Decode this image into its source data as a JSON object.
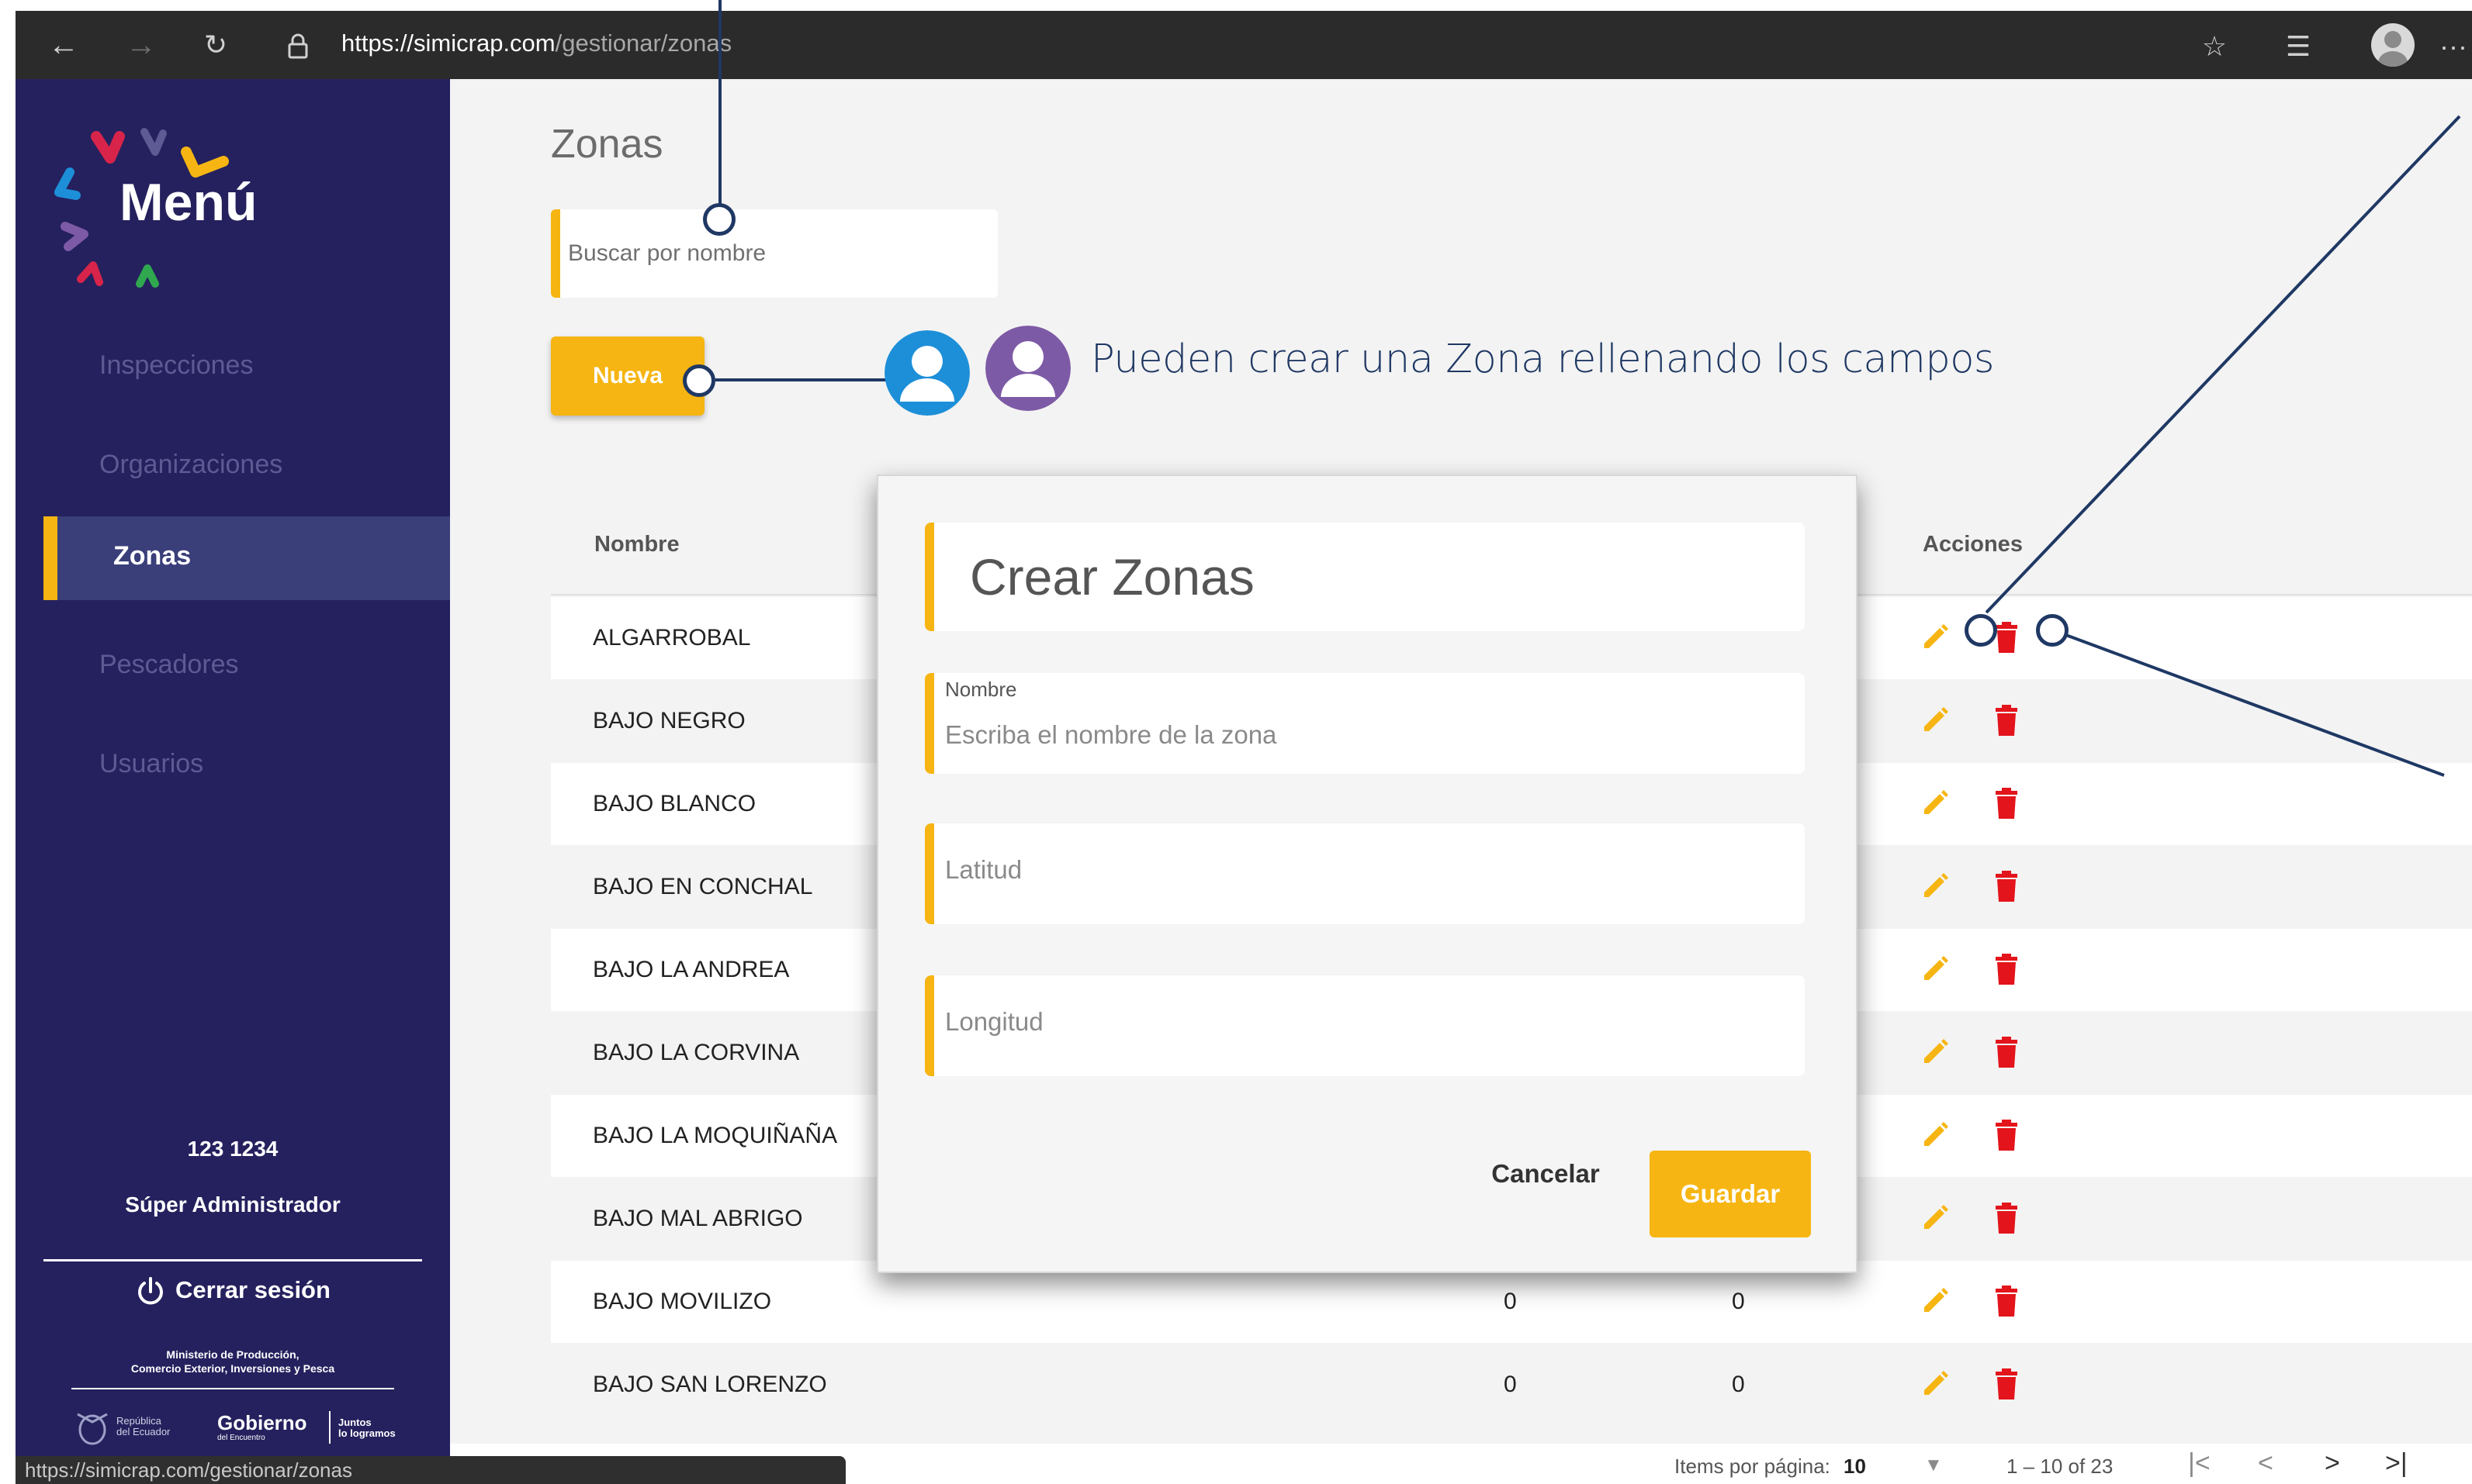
{
  "browser": {
    "url_host": "https://simicrap.com",
    "url_path": "/gestionar/zonas",
    "back_icon": "arrow-left-icon",
    "forward_icon": "arrow-right-icon",
    "refresh_icon": "refresh-icon",
    "lock_icon": "lock-icon",
    "favorite_icon": "star-icon",
    "collections_icon": "favorites-list-icon",
    "profile_icon": "profile-avatar-icon",
    "more_icon": "more-horizontal-icon",
    "status_url": "https://simicrap.com/gestionar/zonas"
  },
  "sidebar": {
    "title": "Menú",
    "items": [
      {
        "label": "Inspecciones",
        "active": false
      },
      {
        "label": "Organizaciones",
        "active": false
      },
      {
        "label": "Zonas",
        "active": true
      },
      {
        "label": "Pescadores",
        "active": false
      },
      {
        "label": "Usuarios",
        "active": false
      }
    ],
    "user_number": "123 1234",
    "user_role": "Súper Administrador",
    "logout_label": "Cerrar sesión",
    "ministry_line1": "Ministerio de Producción,",
    "ministry_line2": "Comercio Exterior, Inversiones y Pesca",
    "republic_line1": "República",
    "republic_line2": "del Ecuador",
    "gob_label": "Gobierno",
    "gob_sub": "del Encuentro",
    "juntos_line1": "Juntos",
    "juntos_line2": "lo logramos"
  },
  "main": {
    "title": "Zonas",
    "search_placeholder": "Buscar por nombre",
    "new_button": "Nueva",
    "annotation": "Pueden crear una Zona rellenando los campos",
    "table": {
      "col_name": "Nombre",
      "col_actions": "Acciones",
      "rows": [
        {
          "name": "ALGARROBAL",
          "v1": "",
          "v2": ""
        },
        {
          "name": "BAJO NEGRO",
          "v1": "",
          "v2": ""
        },
        {
          "name": "BAJO BLANCO",
          "v1": "",
          "v2": ""
        },
        {
          "name": "BAJO EN CONCHAL",
          "v1": "",
          "v2": ""
        },
        {
          "name": "BAJO LA ANDREA",
          "v1": "",
          "v2": ""
        },
        {
          "name": "BAJO LA CORVINA",
          "v1": "",
          "v2": ""
        },
        {
          "name": "BAJO LA MOQUIÑAÑA",
          "v1": "",
          "v2": ""
        },
        {
          "name": "BAJO MAL ABRIGO",
          "v1": "",
          "v2": ""
        },
        {
          "name": "BAJO MOVILIZO",
          "v1": "0",
          "v2": "0"
        },
        {
          "name": "BAJO SAN LORENZO",
          "v1": "0",
          "v2": "0"
        }
      ]
    },
    "pager": {
      "items_label": "Items por página:",
      "items_value": "10",
      "range": "1 – 10 of 23"
    }
  },
  "modal": {
    "title": "Crear Zonas",
    "name_label": "Nombre",
    "name_placeholder": "Escriba el nombre de la zona",
    "lat_placeholder": "Latitud",
    "lon_placeholder": "Longitud",
    "cancel_label": "Cancelar",
    "save_label": "Guardar"
  },
  "colors": {
    "sidebar_bg": "#25215e",
    "accent": "#f6b512",
    "delete": "#e3141b",
    "annotation": "#1f3864",
    "persona_blue": "#1d8fd8",
    "persona_purple": "#7d5aa6"
  }
}
